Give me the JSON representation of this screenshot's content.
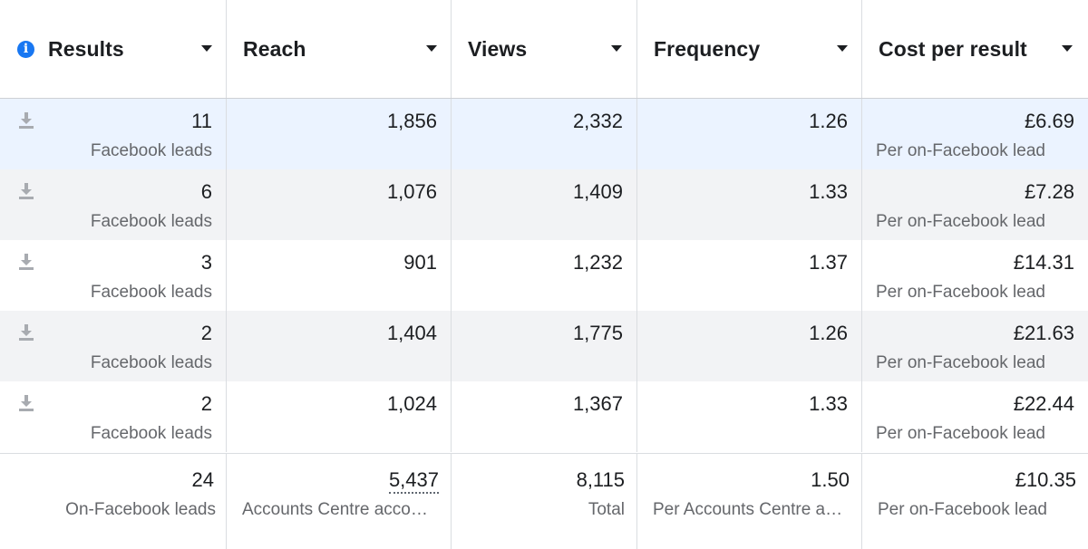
{
  "columns": [
    {
      "label": "Results",
      "has_info_icon": true
    },
    {
      "label": "Reach"
    },
    {
      "label": "Views"
    },
    {
      "label": "Frequency"
    },
    {
      "label": "Cost per result"
    }
  ],
  "rows": [
    {
      "results": "11",
      "results_sub": "Facebook leads",
      "reach": "1,856",
      "views": "2,332",
      "frequency": "1.26",
      "cost": "£6.69",
      "cost_sub": "Per on-Facebook lead",
      "highlight": "selected"
    },
    {
      "results": "6",
      "results_sub": "Facebook leads",
      "reach": "1,076",
      "views": "1,409",
      "frequency": "1.33",
      "cost": "£7.28",
      "cost_sub": "Per on-Facebook lead",
      "highlight": "striped"
    },
    {
      "results": "3",
      "results_sub": "Facebook leads",
      "reach": "901",
      "views": "1,232",
      "frequency": "1.37",
      "cost": "£14.31",
      "cost_sub": "Per on-Facebook lead",
      "highlight": "none"
    },
    {
      "results": "2",
      "results_sub": "Facebook leads",
      "reach": "1,404",
      "views": "1,775",
      "frequency": "1.26",
      "cost": "£21.63",
      "cost_sub": "Per on-Facebook lead",
      "highlight": "striped"
    },
    {
      "results": "2",
      "results_sub": "Facebook leads",
      "reach": "1,024",
      "views": "1,367",
      "frequency": "1.33",
      "cost": "£22.44",
      "cost_sub": "Per on-Facebook lead",
      "highlight": "none"
    }
  ],
  "totals": {
    "results": "24",
    "results_sub": "On-Facebook leads",
    "reach": "5,437",
    "reach_sub": "Accounts Centre accounts",
    "views": "8,115",
    "views_sub": "Total",
    "frequency": "1.50",
    "frequency_sub": "Per Accounts Centre account",
    "cost": "£10.35",
    "cost_sub": "Per on-Facebook lead"
  },
  "icons": {
    "info": "info-icon",
    "sort": "caret-down-icon",
    "row": "download-icon"
  },
  "colors": {
    "selected_row": "#ebf3ff",
    "striped_row": "#f2f3f5",
    "info_blue": "#1877f2",
    "border": "#dadde1",
    "secondary_text": "#65676b"
  }
}
